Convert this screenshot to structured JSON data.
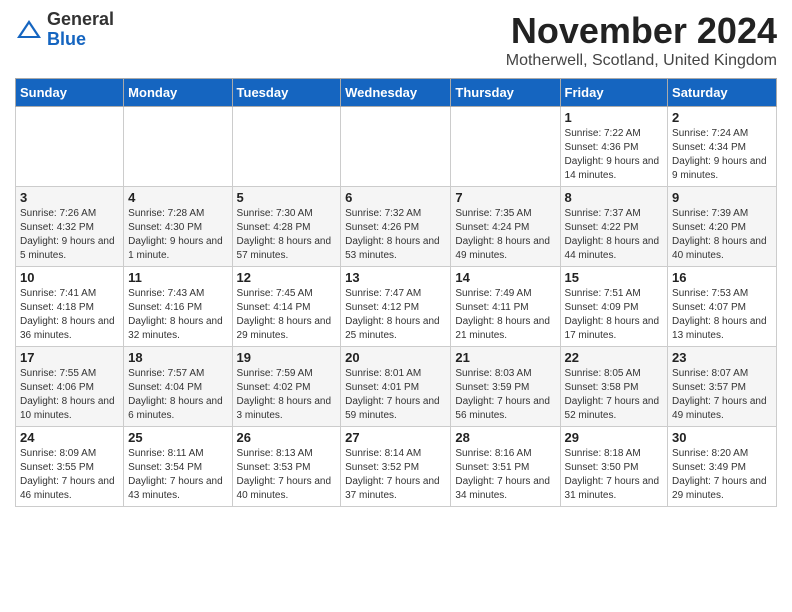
{
  "logo": {
    "general": "General",
    "blue": "Blue"
  },
  "title": "November 2024",
  "subtitle": "Motherwell, Scotland, United Kingdom",
  "days_header": [
    "Sunday",
    "Monday",
    "Tuesday",
    "Wednesday",
    "Thursday",
    "Friday",
    "Saturday"
  ],
  "weeks": [
    [
      {
        "day": "",
        "info": ""
      },
      {
        "day": "",
        "info": ""
      },
      {
        "day": "",
        "info": ""
      },
      {
        "day": "",
        "info": ""
      },
      {
        "day": "",
        "info": ""
      },
      {
        "day": "1",
        "info": "Sunrise: 7:22 AM\nSunset: 4:36 PM\nDaylight: 9 hours and 14 minutes."
      },
      {
        "day": "2",
        "info": "Sunrise: 7:24 AM\nSunset: 4:34 PM\nDaylight: 9 hours and 9 minutes."
      }
    ],
    [
      {
        "day": "3",
        "info": "Sunrise: 7:26 AM\nSunset: 4:32 PM\nDaylight: 9 hours and 5 minutes."
      },
      {
        "day": "4",
        "info": "Sunrise: 7:28 AM\nSunset: 4:30 PM\nDaylight: 9 hours and 1 minute."
      },
      {
        "day": "5",
        "info": "Sunrise: 7:30 AM\nSunset: 4:28 PM\nDaylight: 8 hours and 57 minutes."
      },
      {
        "day": "6",
        "info": "Sunrise: 7:32 AM\nSunset: 4:26 PM\nDaylight: 8 hours and 53 minutes."
      },
      {
        "day": "7",
        "info": "Sunrise: 7:35 AM\nSunset: 4:24 PM\nDaylight: 8 hours and 49 minutes."
      },
      {
        "day": "8",
        "info": "Sunrise: 7:37 AM\nSunset: 4:22 PM\nDaylight: 8 hours and 44 minutes."
      },
      {
        "day": "9",
        "info": "Sunrise: 7:39 AM\nSunset: 4:20 PM\nDaylight: 8 hours and 40 minutes."
      }
    ],
    [
      {
        "day": "10",
        "info": "Sunrise: 7:41 AM\nSunset: 4:18 PM\nDaylight: 8 hours and 36 minutes."
      },
      {
        "day": "11",
        "info": "Sunrise: 7:43 AM\nSunset: 4:16 PM\nDaylight: 8 hours and 32 minutes."
      },
      {
        "day": "12",
        "info": "Sunrise: 7:45 AM\nSunset: 4:14 PM\nDaylight: 8 hours and 29 minutes."
      },
      {
        "day": "13",
        "info": "Sunrise: 7:47 AM\nSunset: 4:12 PM\nDaylight: 8 hours and 25 minutes."
      },
      {
        "day": "14",
        "info": "Sunrise: 7:49 AM\nSunset: 4:11 PM\nDaylight: 8 hours and 21 minutes."
      },
      {
        "day": "15",
        "info": "Sunrise: 7:51 AM\nSunset: 4:09 PM\nDaylight: 8 hours and 17 minutes."
      },
      {
        "day": "16",
        "info": "Sunrise: 7:53 AM\nSunset: 4:07 PM\nDaylight: 8 hours and 13 minutes."
      }
    ],
    [
      {
        "day": "17",
        "info": "Sunrise: 7:55 AM\nSunset: 4:06 PM\nDaylight: 8 hours and 10 minutes."
      },
      {
        "day": "18",
        "info": "Sunrise: 7:57 AM\nSunset: 4:04 PM\nDaylight: 8 hours and 6 minutes."
      },
      {
        "day": "19",
        "info": "Sunrise: 7:59 AM\nSunset: 4:02 PM\nDaylight: 8 hours and 3 minutes."
      },
      {
        "day": "20",
        "info": "Sunrise: 8:01 AM\nSunset: 4:01 PM\nDaylight: 7 hours and 59 minutes."
      },
      {
        "day": "21",
        "info": "Sunrise: 8:03 AM\nSunset: 3:59 PM\nDaylight: 7 hours and 56 minutes."
      },
      {
        "day": "22",
        "info": "Sunrise: 8:05 AM\nSunset: 3:58 PM\nDaylight: 7 hours and 52 minutes."
      },
      {
        "day": "23",
        "info": "Sunrise: 8:07 AM\nSunset: 3:57 PM\nDaylight: 7 hours and 49 minutes."
      }
    ],
    [
      {
        "day": "24",
        "info": "Sunrise: 8:09 AM\nSunset: 3:55 PM\nDaylight: 7 hours and 46 minutes."
      },
      {
        "day": "25",
        "info": "Sunrise: 8:11 AM\nSunset: 3:54 PM\nDaylight: 7 hours and 43 minutes."
      },
      {
        "day": "26",
        "info": "Sunrise: 8:13 AM\nSunset: 3:53 PM\nDaylight: 7 hours and 40 minutes."
      },
      {
        "day": "27",
        "info": "Sunrise: 8:14 AM\nSunset: 3:52 PM\nDaylight: 7 hours and 37 minutes."
      },
      {
        "day": "28",
        "info": "Sunrise: 8:16 AM\nSunset: 3:51 PM\nDaylight: 7 hours and 34 minutes."
      },
      {
        "day": "29",
        "info": "Sunrise: 8:18 AM\nSunset: 3:50 PM\nDaylight: 7 hours and 31 minutes."
      },
      {
        "day": "30",
        "info": "Sunrise: 8:20 AM\nSunset: 3:49 PM\nDaylight: 7 hours and 29 minutes."
      }
    ]
  ]
}
